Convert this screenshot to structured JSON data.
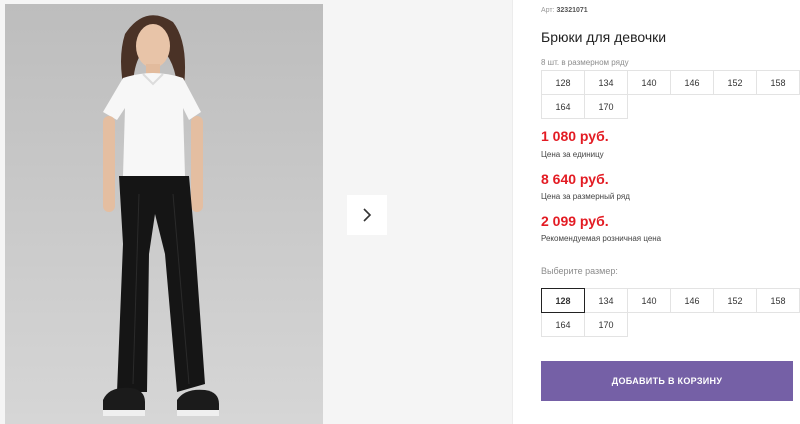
{
  "product": {
    "article_label": "Арт:",
    "article_number": "32321071",
    "title": "Брюки для девочки"
  },
  "size_row": {
    "hint": "8 шт. в размерном ряду",
    "sizes": [
      "128",
      "134",
      "140",
      "146",
      "152",
      "158",
      "164",
      "170"
    ]
  },
  "prices": [
    {
      "value": "1 080 руб.",
      "label": "Цена за единицу"
    },
    {
      "value": "8 640 руб.",
      "label": "Цена за размерный ряд"
    },
    {
      "value": "2 099 руб.",
      "label": "Рекомендуемая розничная цена"
    }
  ],
  "size_select": {
    "hint": "Выберите размер:",
    "sizes": [
      "128",
      "134",
      "140",
      "146",
      "152",
      "158",
      "164",
      "170"
    ],
    "selected": "128"
  },
  "cart_button": {
    "label": "ДОБАВИТЬ В КОРЗИНУ"
  },
  "gallery": {
    "next_icon": "chevron-right-icon"
  },
  "colors": {
    "price": "#e31b23",
    "button": "#7560a6"
  }
}
